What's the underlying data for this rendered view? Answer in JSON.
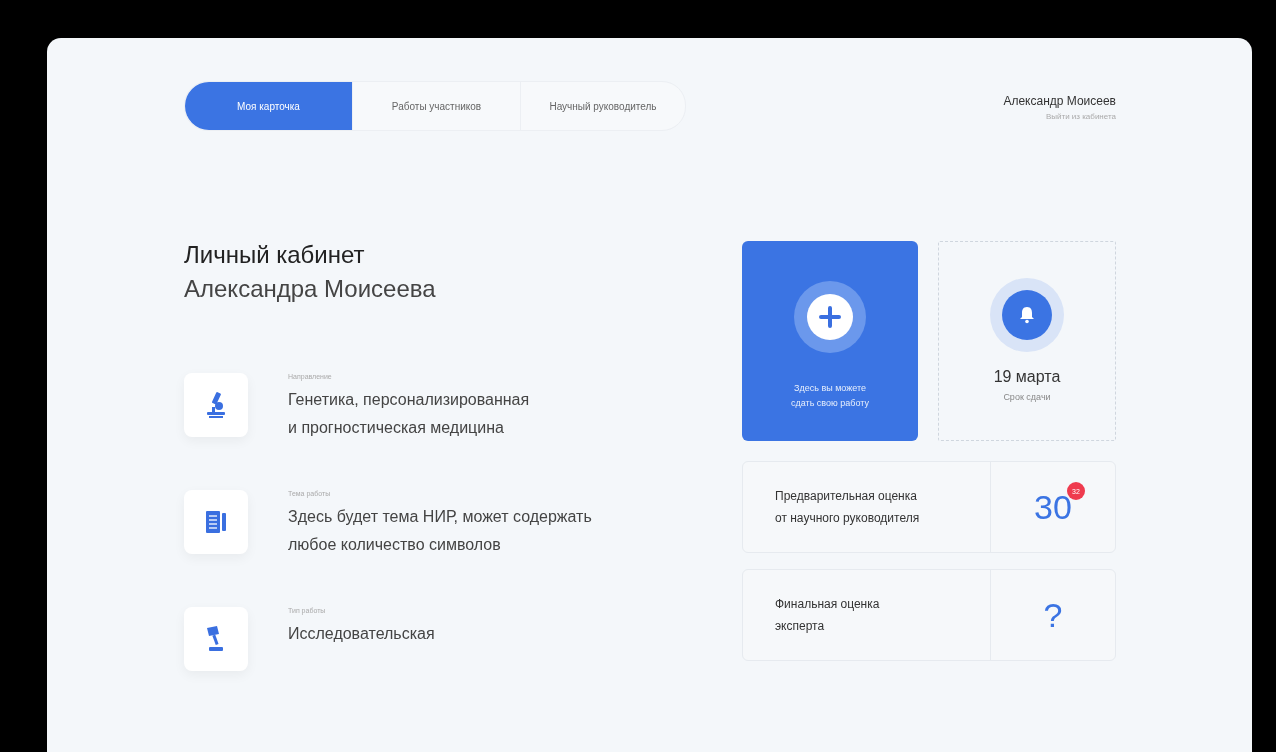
{
  "tabs": [
    {
      "label": "Моя карточка",
      "selected": true
    },
    {
      "label": "Работы участников",
      "selected": false
    },
    {
      "label": "Научный руководитель",
      "selected": false
    }
  ],
  "user": {
    "name": "Александр Моисеев",
    "logout": "Выйти из кабинета"
  },
  "heading": {
    "line1": "Личный кабинет",
    "line2": "Александра Моисеева"
  },
  "info": [
    {
      "kind": "microscope",
      "label": "Направление",
      "lines": [
        "Генетика, персонализированная",
        "и прогностическая медицина"
      ]
    },
    {
      "kind": "notebook",
      "label": "Тема работы",
      "lines": [
        "Здесь будет тема НИР, может содержать",
        "любое количество символов"
      ]
    },
    {
      "kind": "lamp",
      "label": "Тип работы",
      "lines": [
        "Исследовательская"
      ]
    }
  ],
  "upload": {
    "text": [
      "Здесь вы можете",
      "сдать свою работу"
    ]
  },
  "deadline": {
    "date": "19 марта",
    "label": "Срок сдачи"
  },
  "scores": [
    {
      "label": [
        "Предварительная оценка",
        "от научного руководителя"
      ],
      "value": "30",
      "badge": "32"
    },
    {
      "label": [
        "Финальная оценка",
        "эксперта"
      ],
      "value": "?"
    }
  ]
}
